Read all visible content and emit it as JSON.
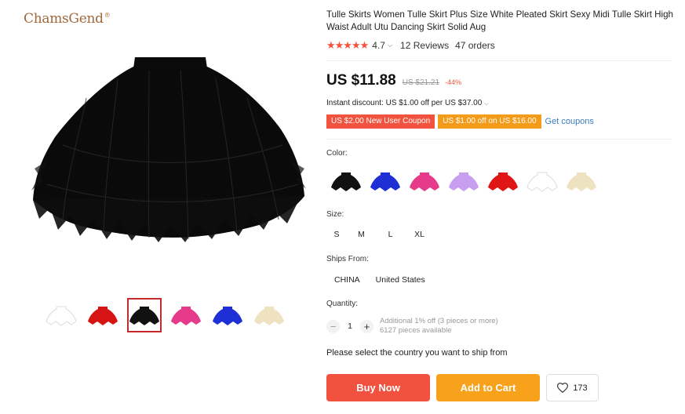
{
  "brand": {
    "name": "ChamsGend",
    "mark": "®"
  },
  "product": {
    "title": "Tulle Skirts Women Tulle Skirt Plus Size White Pleated Skirt Sexy Midi Tulle Skirt High Waist Adult Utu Dancing Skirt Solid Aug",
    "stars": "★★★★★",
    "rating": "4.7",
    "reviews": "12 Reviews",
    "orders": "47 orders",
    "price": "US $11.88",
    "old_price": "US $21.21",
    "discount": "-44%",
    "instant_discount": "Instant discount: US $1.00 off per US $37.00",
    "coupons": [
      "US $2.00 New User Coupon",
      "US $1.00 off on US $16.00"
    ],
    "get_coupons": "Get coupons"
  },
  "thumbnails": [
    {
      "color": "#ffffff",
      "outline": "#dddddd"
    },
    {
      "color": "#d61414",
      "outline": "#d61414"
    },
    {
      "color": "#111111",
      "outline": "#111111"
    },
    {
      "color": "#e63a8a",
      "outline": "#e63a8a"
    },
    {
      "color": "#1f2fd6",
      "outline": "#1f2fd6"
    },
    {
      "color": "#efe2c0",
      "outline": "#e5d6b0"
    }
  ],
  "color_label": "Color:",
  "colors": [
    {
      "color": "#111111",
      "outline": "#111111"
    },
    {
      "color": "#1f2fd6",
      "outline": "#1f2fd6"
    },
    {
      "color": "#e63a8a",
      "outline": "#e63a8a"
    },
    {
      "color": "#c79ef0",
      "outline": "#c79ef0"
    },
    {
      "color": "#e01515",
      "outline": "#e01515"
    },
    {
      "color": "#ffffff",
      "outline": "#dddddd"
    },
    {
      "color": "#efe2c0",
      "outline": "#e5d6b0"
    }
  ],
  "size_label": "Size:",
  "sizes": [
    "S",
    "M",
    "L",
    "XL"
  ],
  "ships_label": "Ships From:",
  "ships_from": [
    "CHINA",
    "United States"
  ],
  "quantity_label": "Quantity:",
  "quantity": {
    "minus": "−",
    "value": "1",
    "plus": "+",
    "additional": "Additional 1% off (3 pieces or more)",
    "available": "6127 pieces available"
  },
  "ship_prompt": "Please select the country you want to ship from",
  "buttons": {
    "buy": "Buy Now",
    "cart": "Add to Cart",
    "wishlist_count": "173"
  }
}
